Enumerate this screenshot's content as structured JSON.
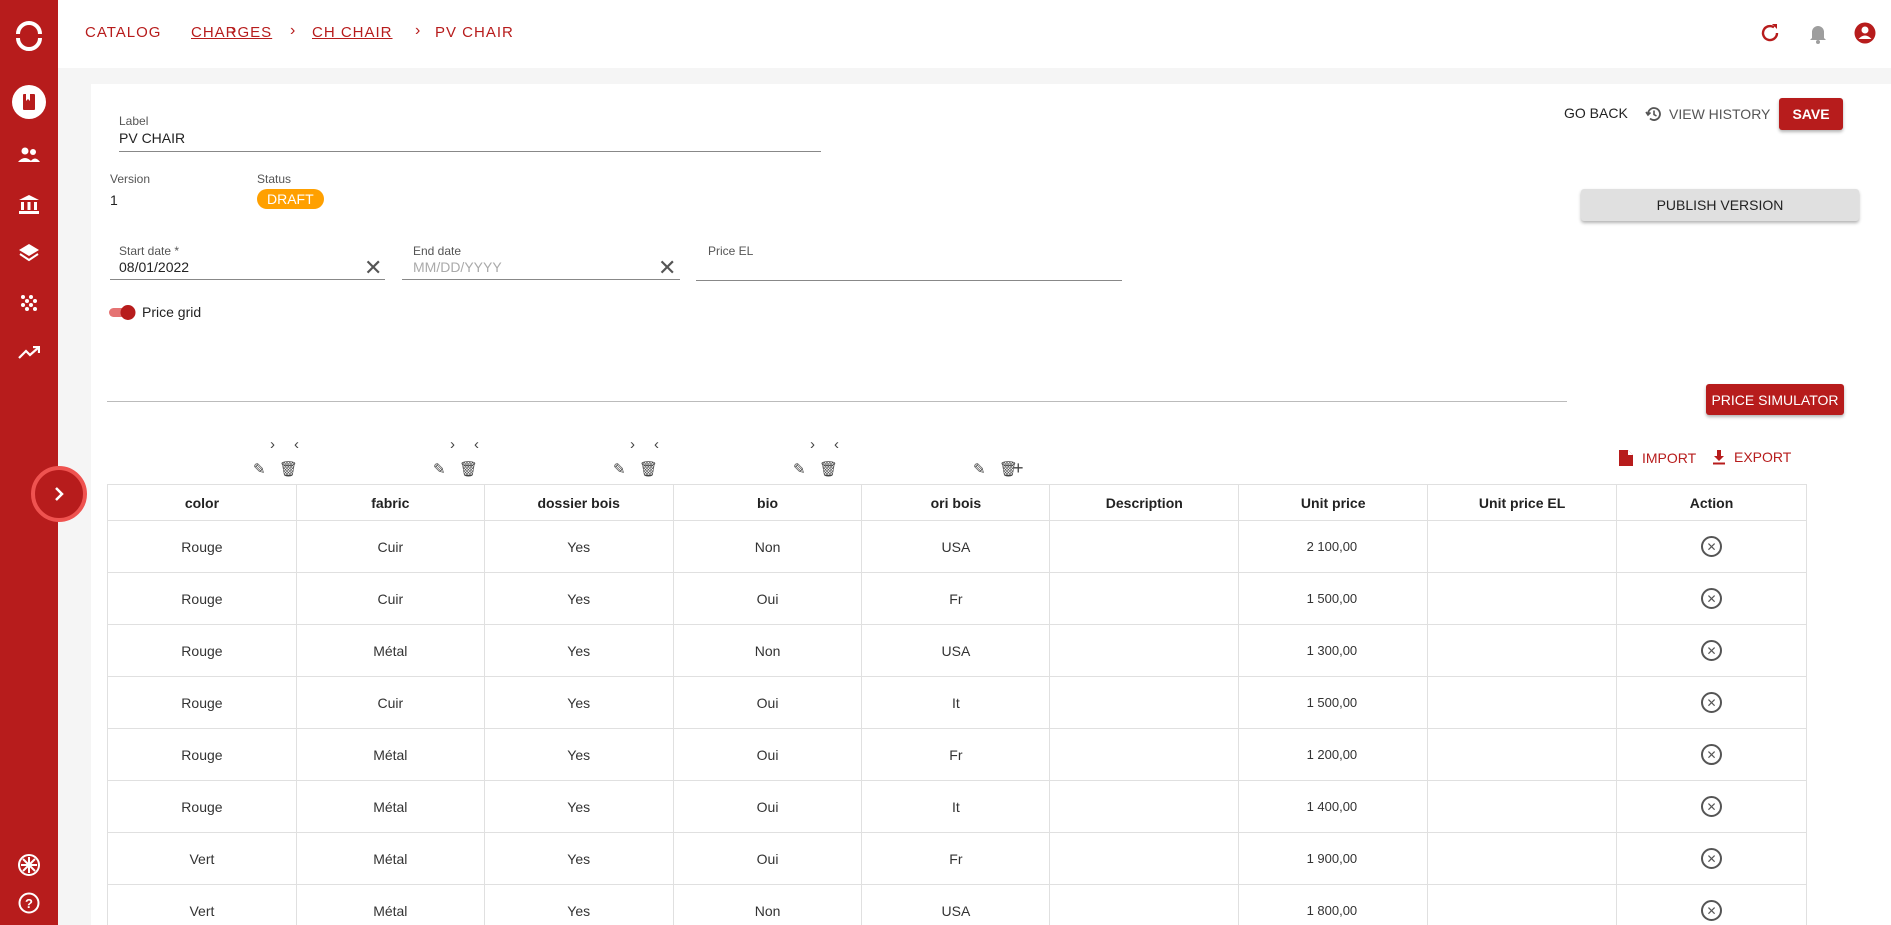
{
  "breadcrumb": [
    {
      "label": "CATALOG",
      "underline": false
    },
    {
      "label": "CHARGES",
      "underline": true
    },
    {
      "label": "CH CHAIR",
      "underline": true
    },
    {
      "label": "PV CHAIR",
      "underline": false
    }
  ],
  "form": {
    "label_caption": "Label",
    "label_value": "PV CHAIR",
    "version_caption": "Version",
    "version_value": "1",
    "status_caption": "Status",
    "status_value": "DRAFT",
    "start_date_caption": "Start date *",
    "start_date_value": "08/01/2022",
    "end_date_caption": "End date",
    "end_date_placeholder": "MM/DD/YYYY",
    "price_el_caption": "Price EL",
    "price_grid_label": "Price grid"
  },
  "actions": {
    "go_back": "GO BACK",
    "view_history": "VIEW HISTORY",
    "save": "SAVE",
    "publish_version": "PUBLISH VERSION",
    "price_simulator": "PRICE SIMULATOR",
    "import": "IMPORT",
    "export": "EXPORT"
  },
  "table": {
    "columns": [
      "color",
      "fabric",
      "dossier bois",
      "bio",
      "ori bois",
      "Description",
      "Unit price",
      "Unit price EL",
      "Action"
    ],
    "rows": [
      [
        "Rouge",
        "Cuir",
        "Yes",
        "Non",
        "USA",
        "",
        "2 100,00",
        ""
      ],
      [
        "Rouge",
        "Cuir",
        "Yes",
        "Oui",
        "Fr",
        "",
        "1 500,00",
        ""
      ],
      [
        "Rouge",
        "Métal",
        "Yes",
        "Non",
        "USA",
        "",
        "1 300,00",
        ""
      ],
      [
        "Rouge",
        "Cuir",
        "Yes",
        "Oui",
        "It",
        "",
        "1 500,00",
        ""
      ],
      [
        "Rouge",
        "Métal",
        "Yes",
        "Oui",
        "Fr",
        "",
        "1 200,00",
        ""
      ],
      [
        "Rouge",
        "Métal",
        "Yes",
        "Oui",
        "It",
        "",
        "1 400,00",
        ""
      ],
      [
        "Vert",
        "Métal",
        "Yes",
        "Oui",
        "Fr",
        "",
        "1 900,00",
        ""
      ],
      [
        "Vert",
        "Métal",
        "Yes",
        "Non",
        "USA",
        "",
        "1 800,00",
        ""
      ]
    ]
  },
  "colors": {
    "brand": "#b71c1c",
    "status_draft": "#ffa000"
  }
}
